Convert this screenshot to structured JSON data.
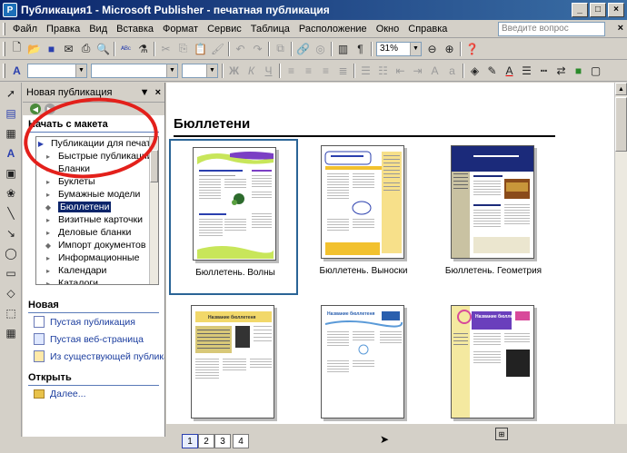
{
  "window": {
    "title": "Публикация1 - Microsoft Publisher - печатная публикация",
    "app_icon": "publisher-icon"
  },
  "menu": {
    "items": [
      "Файл",
      "Правка",
      "Вид",
      "Вставка",
      "Формат",
      "Сервис",
      "Таблица",
      "Расположение",
      "Окно",
      "Справка"
    ],
    "ask_placeholder": "Введите вопрос"
  },
  "toolbar": {
    "zoom": "31%"
  },
  "taskpane": {
    "title": "Новая публикация",
    "section_start": "Начать с макета",
    "tree_root": "Публикации для печати",
    "tree_items": [
      "Быстрые публикации",
      "Бланки",
      "Буклеты",
      "Бумажные модели",
      "Бюллетени",
      "Визитные карточки",
      "Деловые бланки",
      "Импорт документов",
      "Информационные",
      "Календари",
      "Каталоги"
    ],
    "tree_selected_index": 4,
    "section_new": "Новая",
    "new_links": [
      "Пустая публикация",
      "Пустая веб-страница",
      "Из существующей публикации"
    ],
    "section_open": "Открыть",
    "open_links": [
      "Далее..."
    ]
  },
  "main": {
    "category_title": "Бюллетени",
    "thumbnails": [
      {
        "label": "Бюллетень. Волны",
        "selected": true
      },
      {
        "label": "Бюллетень. Выноски",
        "selected": false
      },
      {
        "label": "Бюллетень. Геометрия",
        "selected": false
      },
      {
        "label": "",
        "selected": false
      },
      {
        "label": "",
        "selected": false
      },
      {
        "label": "",
        "selected": false
      }
    ]
  },
  "thumb_text": {
    "t2": "Название бюллетеня",
    "t3": "Название бюллетеня",
    "t4": "Название бюллетеня",
    "t5": "Название бюллетеня",
    "t6": "Название бюллетеня"
  },
  "page_nav": [
    "1",
    "2",
    "3",
    "4"
  ],
  "colors": {
    "title_bar": "#0a246a",
    "selection": "#0a246a",
    "annotation_circle": "#e3201b",
    "thumb_selected_border": "#2a6496"
  }
}
